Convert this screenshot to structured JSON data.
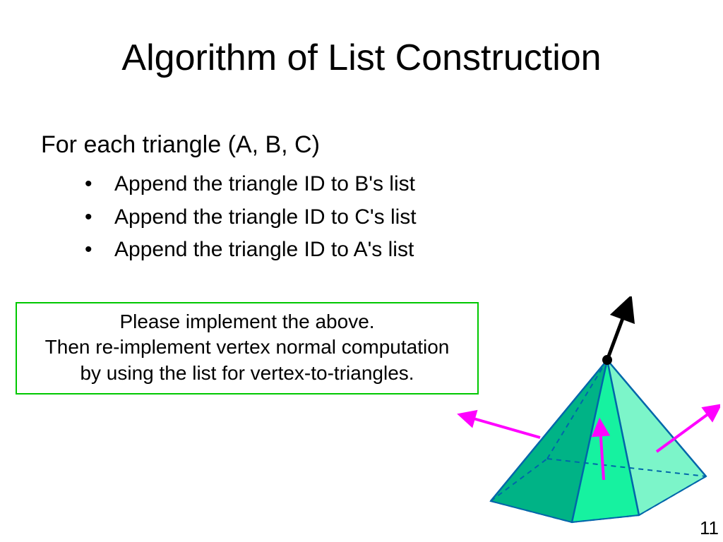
{
  "title": "Algorithm of List Construction",
  "intro": "For each triangle (A, B, C)",
  "bullets": [
    "Append the triangle ID to B's list",
    "Append the triangle ID to C's list",
    "Append the triangle ID to A's list"
  ],
  "note": {
    "line1": "Please implement the above.",
    "line2": "Then re-implement vertex normal computation",
    "line3": "by using the list for vertex-to-triangles."
  },
  "page_number": "11"
}
